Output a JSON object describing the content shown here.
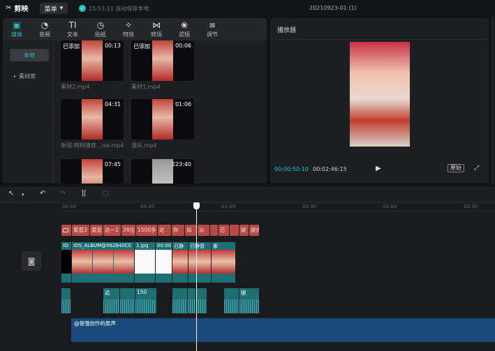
{
  "app": {
    "name": "剪映",
    "menu_label": "菜单",
    "save_status": "15:53:11 自动保存本地",
    "project_title": "20210923-01 (1)"
  },
  "tabs": [
    {
      "label": "媒体",
      "icon": "media-icon"
    },
    {
      "label": "音频",
      "icon": "audio-icon"
    },
    {
      "label": "文本",
      "icon": "text-icon"
    },
    {
      "label": "贴纸",
      "icon": "sticker-icon"
    },
    {
      "label": "特效",
      "icon": "effects-icon"
    },
    {
      "label": "转场",
      "icon": "transition-icon"
    },
    {
      "label": "滤镜",
      "icon": "filter-icon"
    },
    {
      "label": "调节",
      "icon": "adjust-icon"
    }
  ],
  "sidebar": {
    "local": "本地",
    "library": "素材库"
  },
  "media": [
    {
      "name": "素材2.mp4",
      "duration": "00:13",
      "added": "已添加"
    },
    {
      "name": "素材1.mp4",
      "duration": "00:06",
      "added": "已添加"
    },
    {
      "name": "新视-韩韩情感...lse.mp4",
      "duration": "04:31",
      "added": ""
    },
    {
      "name": "馒头.mp4",
      "duration": "01:06",
      "added": ""
    },
    {
      "name": "",
      "duration": "07:45",
      "added": ""
    },
    {
      "name": "",
      "duration": "223:40",
      "added": ""
    }
  ],
  "player": {
    "title": "播放器",
    "current_time": "00:00:50:10",
    "total_time": "00:02:46:15",
    "original_label": "原始"
  },
  "timeline": {
    "ruler": [
      "00:00",
      "00:30",
      "01:00",
      "01:30",
      "02:00",
      "02:30"
    ],
    "text_clips": [
      "爱逛3",
      "爱逛",
      "这一2",
      "26位",
      "1500多",
      "这",
      "你",
      "如",
      "点",
      "",
      "已",
      "",
      "提",
      "提供"
    ],
    "video_clips": [
      "IO",
      "IOS_ALBUM@062840CE",
      "1.jpg",
      "00:00",
      "已静",
      "已静音",
      "素"
    ],
    "audio_clips": [
      "",
      "",
      "这",
      "",
      "150",
      "",
      "",
      "",
      "",
      "",
      "提"
    ],
    "original_audio": "@俊强创作的原声"
  }
}
